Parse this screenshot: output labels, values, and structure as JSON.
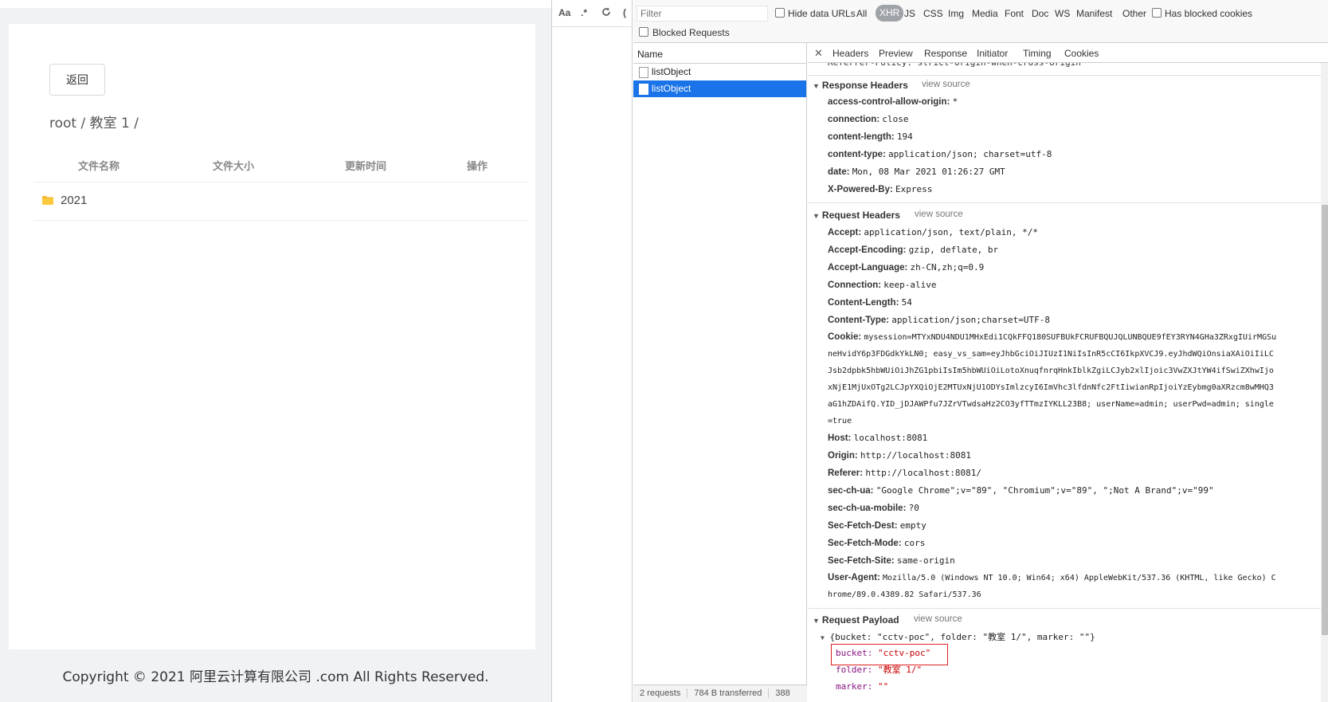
{
  "app": {
    "back_label": "返回",
    "breadcrumb": "root / 教室 1 /",
    "columns": [
      "文件名称",
      "文件大小",
      "更新时间",
      "操作"
    ],
    "rows": [
      {
        "name": "2021"
      }
    ],
    "footer": "Copyright © 2021 阿里云计算有限公司 .com All Rights Reserved."
  },
  "devtools": {
    "toolbar": {
      "case": "Aa",
      "regex": ".*",
      "reload": "C",
      "next": "("
    },
    "filter": {
      "placeholder": "Filter",
      "hide_data_urls": "Hide data URLs",
      "types": [
        "All",
        "XHR",
        "JS",
        "CSS",
        "Img",
        "Media",
        "Font",
        "Doc",
        "WS",
        "Manifest",
        "Other"
      ],
      "active_type": "XHR",
      "has_blocked_cookies": "Has blocked cookies",
      "blocked_requests": "Blocked Requests"
    },
    "name_header": "Name",
    "requests": [
      "listObject",
      "listObject"
    ],
    "status": {
      "requests": "2 requests",
      "transferred": "784 B transferred",
      "extra": "388"
    },
    "detail_tabs": [
      "Headers",
      "Preview",
      "Response",
      "Initiator",
      "Timing",
      "Cookies"
    ],
    "partial_top": "Referrer-Policy: strict-origin-when-cross-origin",
    "view_source": "view source",
    "response_headers": {
      "title": "Response Headers",
      "items": [
        {
          "k": "access-control-allow-origin:",
          "v": "*"
        },
        {
          "k": "connection:",
          "v": "close"
        },
        {
          "k": "content-length:",
          "v": "194"
        },
        {
          "k": "content-type:",
          "v": "application/json; charset=utf-8"
        },
        {
          "k": "date:",
          "v": "Mon, 08 Mar 2021 01:26:27 GMT"
        },
        {
          "k": "X-Powered-By:",
          "v": "Express"
        }
      ]
    },
    "request_headers": {
      "title": "Request Headers",
      "items": [
        {
          "k": "Accept:",
          "v": "application/json, text/plain, */*"
        },
        {
          "k": "Accept-Encoding:",
          "v": "gzip, deflate, br"
        },
        {
          "k": "Accept-Language:",
          "v": "zh-CN,zh;q=0.9"
        },
        {
          "k": "Connection:",
          "v": "keep-alive"
        },
        {
          "k": "Content-Length:",
          "v": "54"
        },
        {
          "k": "Content-Type:",
          "v": "application/json;charset=UTF-8"
        }
      ],
      "cookie_key": "Cookie:",
      "cookie_lines": [
        "mysession=MTYxNDU4NDU1MHxEdi1CQkFFQ180SUFBUkFCRUFBQUJQLUNBQUE9fEY3RYN4GHa3ZRxgIUirMGSu",
        "neHvidY6p3FDGdkYkLN0; easy_vs_sam=eyJhbGciOiJIUzI1NiIsInR5cCI6IkpXVCJ9.eyJhdWQiOnsiaXAiOiIiLC",
        "Jsb2dpbk5hbWUiOiJhZG1pbiIsIm5hbWUiOiLotoXnuqfnrqHnkIblkZgiLCJyb2xlIjoic3VwZXJtYW4ifSwiZXhwIjo",
        "xNjE1MjUxOTg2LCJpYXQiOjE2MTUxNjU1ODYsImlzcyI6ImVhc3lfdnNfc2FtIiwianRpIjoiYzEybmg0aXRzcm8wMHQ3",
        "aG1hZDAifQ.YID_jDJAWPfu7JZrVTwdsaHz2CO3yfTTmzIYKLL23B8; userName=admin; userPwd=admin; single",
        "=true"
      ],
      "items2": [
        {
          "k": "Host:",
          "v": "localhost:8081"
        },
        {
          "k": "Origin:",
          "v": "http://localhost:8081"
        },
        {
          "k": "Referer:",
          "v": "http://localhost:8081/"
        },
        {
          "k": "sec-ch-ua:",
          "v": "\"Google Chrome\";v=\"89\", \"Chromium\";v=\"89\", \";Not A Brand\";v=\"99\""
        },
        {
          "k": "sec-ch-ua-mobile:",
          "v": "?0"
        },
        {
          "k": "Sec-Fetch-Dest:",
          "v": "empty"
        },
        {
          "k": "Sec-Fetch-Mode:",
          "v": "cors"
        },
        {
          "k": "Sec-Fetch-Site:",
          "v": "same-origin"
        }
      ],
      "ua_key": "User-Agent:",
      "ua_line1": "Mozilla/5.0 (Windows NT 10.0; Win64; x64) AppleWebKit/537.36 (KHTML, like Gecko) C",
      "ua_line2": "hrome/89.0.4389.82 Safari/537.36"
    },
    "payload": {
      "title": "Request Payload",
      "summary": "{bucket: \"cctv-poc\", folder: \"教室 1/\", marker: \"\"}",
      "fields": [
        {
          "k": "bucket:",
          "v": "\"cctv-poc\""
        },
        {
          "k": "folder:",
          "v": "\"教室 1/\""
        },
        {
          "k": "marker:",
          "v": "\"\""
        }
      ]
    },
    "colors": {
      "selected": "#1a73e8",
      "highlight": "#e02020"
    }
  }
}
